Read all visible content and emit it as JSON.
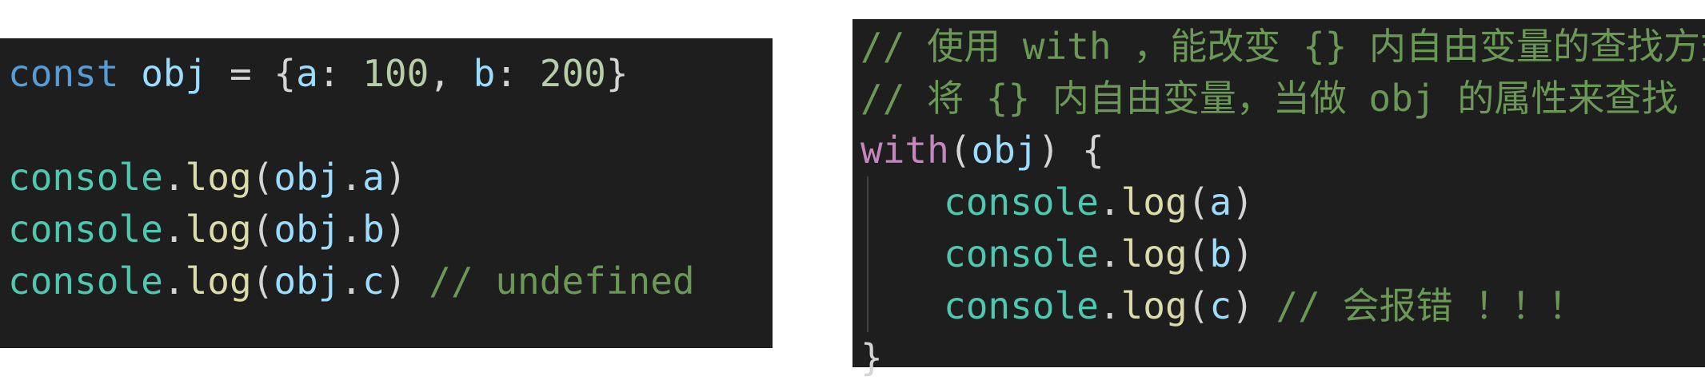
{
  "left_code": {
    "line1": {
      "kw": "const",
      "name": "obj",
      "eq": "=",
      "open": "{",
      "k1": "a",
      "v1": "100",
      "k2": "b",
      "v2": "200",
      "close": "}"
    },
    "calls": [
      {
        "obj": "console",
        "fn": "log",
        "target": "obj",
        "prop": "a",
        "comment": ""
      },
      {
        "obj": "console",
        "fn": "log",
        "target": "obj",
        "prop": "b",
        "comment": ""
      },
      {
        "obj": "console",
        "fn": "log",
        "target": "obj",
        "prop": "c",
        "comment": "// undefined"
      }
    ]
  },
  "right_code": {
    "comment1": "// 使用 with ，能改变 {} 内自由变量的查找方式",
    "comment2": "// 将 {} 内自由变量，当做 obj 的属性来查找",
    "with_kw": "with",
    "with_arg": "obj",
    "open_brace": "{",
    "calls": [
      {
        "obj": "console",
        "fn": "log",
        "arg": "a",
        "comment": ""
      },
      {
        "obj": "console",
        "fn": "log",
        "arg": "b",
        "comment": ""
      },
      {
        "obj": "console",
        "fn": "log",
        "arg": "c",
        "comment": "// 会报错 ！！！"
      }
    ],
    "close_brace": "}"
  },
  "colors": {
    "background": "#1e1e1e",
    "keyword": "#569cd6",
    "control_keyword": "#c586c0",
    "variable": "#9cdcfe",
    "class": "#4ec9b0",
    "function": "#dcdcaa",
    "number": "#b5cea8",
    "comment": "#6a9955"
  }
}
